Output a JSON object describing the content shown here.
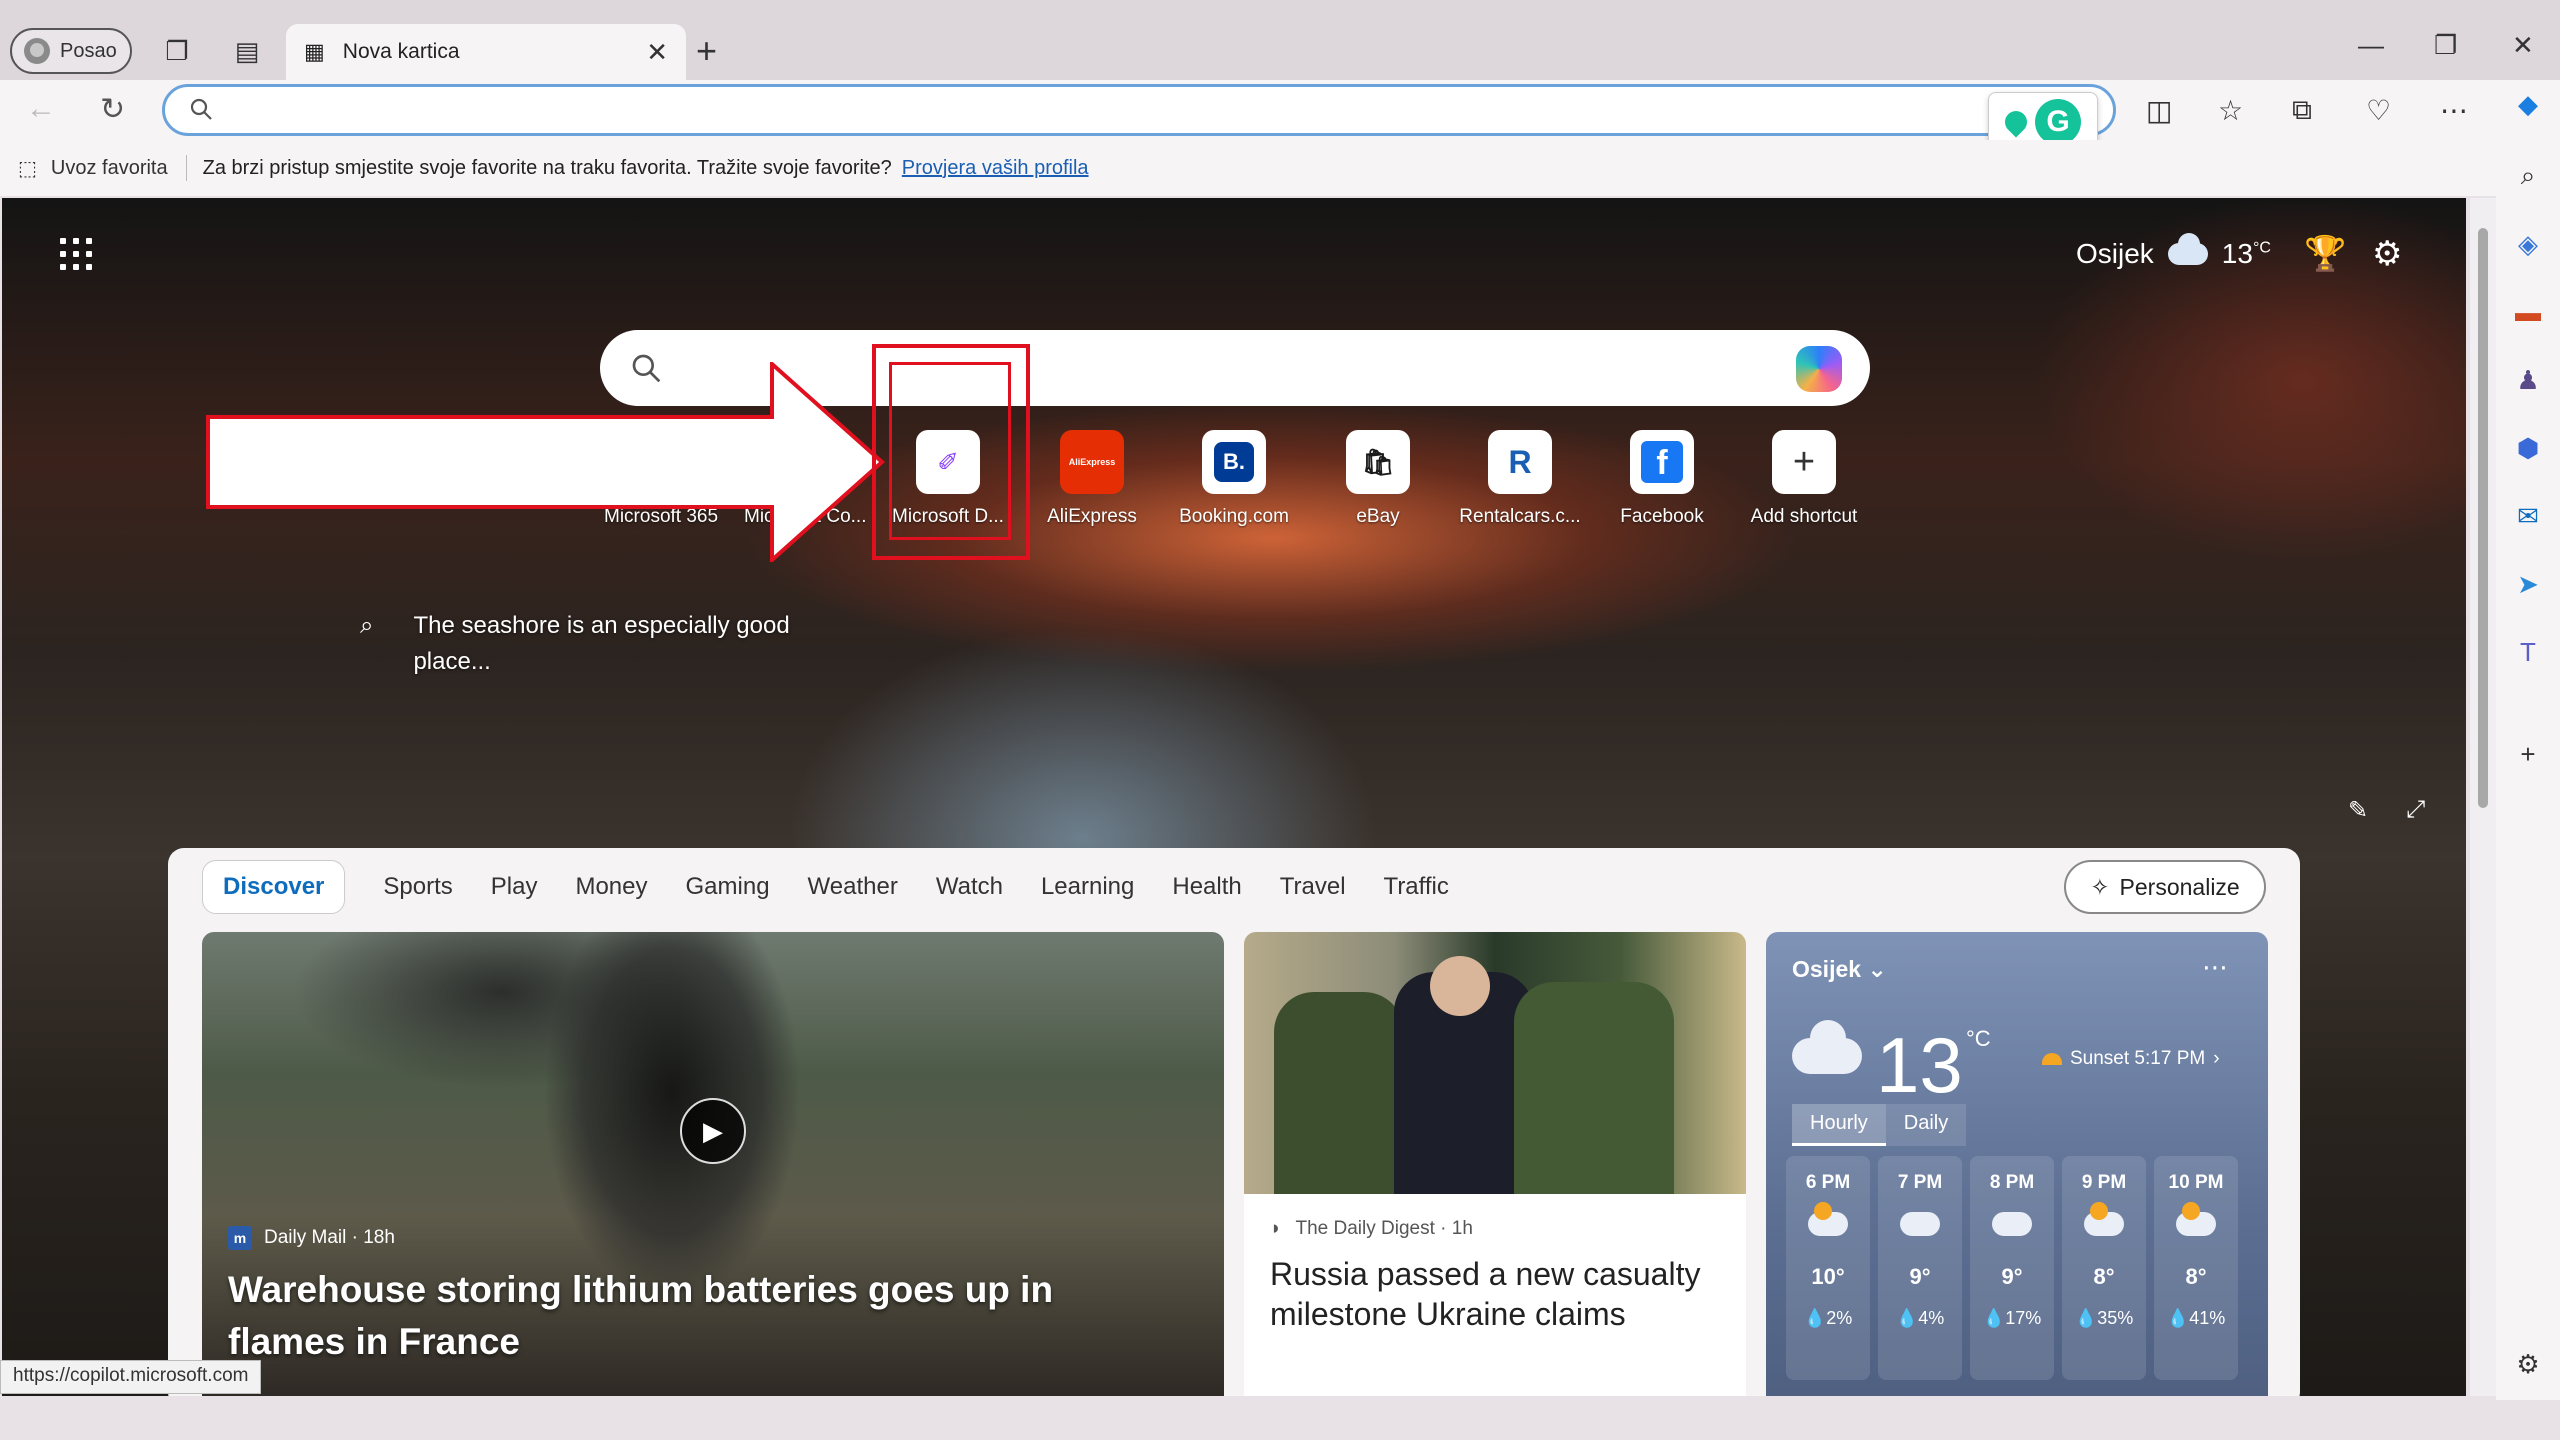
{
  "browser": {
    "profile_label": "Posao",
    "tab_title": "Nova kartica",
    "address_value": "",
    "favbar_import": "Uvoz favorita",
    "favbar_message": "Za brzi pristup smjestite svoje favorite na traku favorita. Tražite svoje favorite?",
    "favbar_link": "Provjera vaših profila",
    "status_url": "https://copilot.microsoft.com"
  },
  "ntp": {
    "weather_city": "Osijek",
    "weather_temp": "13",
    "weather_unit": "°C",
    "search_placeholder": "",
    "shortcuts": [
      {
        "label": "Microsoft 365"
      },
      {
        "label": "Microsoft Co..."
      },
      {
        "label": "Microsoft D...",
        "tile": "✐",
        "color": "#8a3ffc"
      },
      {
        "label": "AliExpress",
        "tile": "AliExpress",
        "color": "#e62e04"
      },
      {
        "label": "Booking.com",
        "tile": "B.",
        "color": "#003b95"
      },
      {
        "label": "eBay",
        "tile": "🛍",
        "color": "#333"
      },
      {
        "label": "Rentalcars.c...",
        "tile": "R",
        "color": "#1a5fb4"
      },
      {
        "label": "Facebook",
        "tile": "f",
        "color": "#1877f2"
      },
      {
        "label": "Add shortcut",
        "tile": "+",
        "color": "#333"
      }
    ],
    "caption": "The seashore is an especially good place..."
  },
  "feed": {
    "tabs": [
      "Discover",
      "Sports",
      "Play",
      "Money",
      "Gaming",
      "Weather",
      "Watch",
      "Learning",
      "Health",
      "Travel",
      "Traffic"
    ],
    "personalize_label": "Personalize",
    "main_card": {
      "source": "Daily Mail · 18h",
      "headline": "Warehouse storing lithium batteries goes up in flames in France"
    },
    "news_card": {
      "source": "The Daily Digest · 1h",
      "headline": "Russia passed a new casualty milestone Ukraine claims"
    },
    "weather_card": {
      "city": "Osijek",
      "temp": "13",
      "unit": "°C",
      "sunset": "Sunset 5:17 PM",
      "tab_hourly": "Hourly",
      "tab_daily": "Daily",
      "hours": [
        {
          "time": "6 PM",
          "temp": "10°",
          "precip": "2%"
        },
        {
          "time": "7 PM",
          "temp": "9°",
          "precip": "4%"
        },
        {
          "time": "8 PM",
          "temp": "9°",
          "precip": "17%"
        },
        {
          "time": "9 PM",
          "temp": "8°",
          "precip": "35%"
        },
        {
          "time": "10 PM",
          "temp": "8°",
          "precip": "41%"
        }
      ]
    }
  },
  "colors": {
    "accent": "#0f6cbd",
    "annotation_red": "#e0101e",
    "omnibox_border": "#6aa3dc"
  }
}
